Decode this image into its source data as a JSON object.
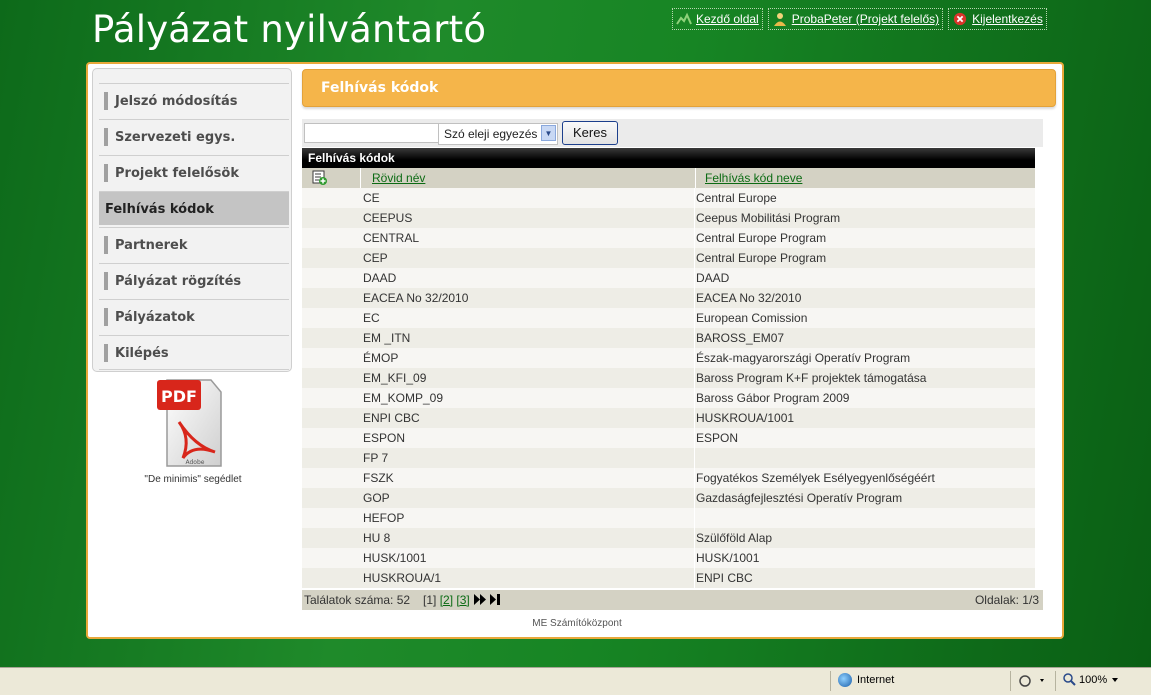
{
  "app": {
    "title": "Pályázat nyilvántartó"
  },
  "top_links": {
    "home": "Kezdő oldal",
    "user": "ProbaPeter (Projekt felelős)",
    "logout": "Kijelentkezés"
  },
  "sidebar": {
    "items": [
      {
        "label": "Jelszó módosítás",
        "active": false
      },
      {
        "label": "Szervezeti egys.",
        "active": false
      },
      {
        "label": "Projekt felelősök",
        "active": false
      },
      {
        "label": "Felhívás kódok",
        "active": true
      },
      {
        "label": "Partnerek",
        "active": false
      },
      {
        "label": "Pályázat rögzítés",
        "active": false
      },
      {
        "label": "Pályázatok",
        "active": false
      },
      {
        "label": "Kilépés",
        "active": false
      }
    ],
    "pdf_caption": "\"De minimis\" segédlet",
    "pdf_badge": "PDF",
    "pdf_brand": "Adobe"
  },
  "page": {
    "header": "Felhívás kódok"
  },
  "search": {
    "value": "",
    "mode": "Szó eleji egyezés",
    "button": "Keres"
  },
  "grid": {
    "title": "Felhívás kódok",
    "columns": [
      "Rövid név",
      "Felhívás kód neve"
    ],
    "rows": [
      [
        "CE",
        "Central Europe"
      ],
      [
        "CEEPUS",
        "Ceepus Mobilitási Program"
      ],
      [
        "CENTRAL",
        "Central Europe Program"
      ],
      [
        "CEP",
        "Central Europe Program"
      ],
      [
        "DAAD",
        "DAAD"
      ],
      [
        "EACEA No 32/2010",
        "EACEA No 32/2010"
      ],
      [
        "EC",
        "European Comission"
      ],
      [
        "EM _ITN",
        "BAROSS_EM07"
      ],
      [
        "ÉMOP",
        "Észak-magyarországi Operatív Program"
      ],
      [
        "EM_KFI_09",
        "Baross Program K+F projektek támogatása"
      ],
      [
        "EM_KOMP_09",
        "Baross Gábor Program 2009"
      ],
      [
        "ENPI CBC",
        "HUSKROUA/1001"
      ],
      [
        "ESPON",
        "ESPON"
      ],
      [
        "FP 7",
        ""
      ],
      [
        "FSZK",
        "Fogyatékos Személyek Esélyegyenlőségéért"
      ],
      [
        "GOP",
        "Gazdaságfejlesztési Operatív Program"
      ],
      [
        "HEFOP",
        ""
      ],
      [
        "HU 8",
        "Szülőföld Alap"
      ],
      [
        "HUSK/1001",
        "HUSK/1001"
      ],
      [
        "HUSKROUA/1",
        "ENPI CBC"
      ]
    ]
  },
  "pager": {
    "count_label": "Találatok száma: 52",
    "current": "[1]",
    "page2": "[2]",
    "page3": "[3]",
    "pages_label": "Oldalak: 1/3"
  },
  "footer": {
    "text": "ME Számítóközpont"
  },
  "statusbar": {
    "zone": "Internet",
    "zoom": "100%"
  },
  "colors": {
    "accent": "#f5b54a",
    "link_green": "#0c6b14",
    "background_green": "#1f8a2a"
  }
}
